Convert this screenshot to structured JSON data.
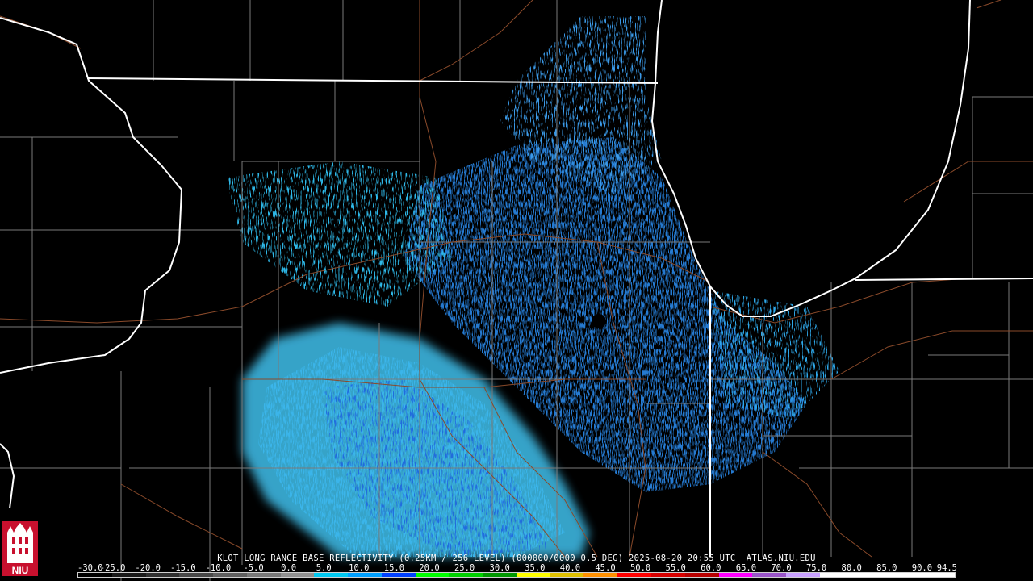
{
  "product": {
    "caption": "KLOT LONG RANGE BASE REFLECTIVITY (0.25KM / 256 LEVEL) (000000/0000 0.5 DEG) 2025-08-20 20:55 UTC  ATLAS.NIU.EDU"
  },
  "logo": {
    "text": "NIU",
    "icon": "niu-tower-icon",
    "color": "#c8102e"
  },
  "scale": {
    "labels": [
      "-30.0",
      "-25.0",
      "-20.0",
      "-15.0",
      "-10.0",
      "-5.0",
      "0.0",
      "5.0",
      "10.0",
      "15.0",
      "20.0",
      "25.0",
      "30.0",
      "35.0",
      "40.0",
      "45.0",
      "50.0",
      "55.0",
      "60.0",
      "65.0",
      "70.0",
      "75.0",
      "80.0",
      "85.0",
      "90.0",
      "94.5"
    ],
    "colors": [
      "#000000",
      "#1a1a1a",
      "#303030",
      "#484848",
      "#606060",
      "#787878",
      "#909090",
      "#00c8f0",
      "#00a0ff",
      "#0040ff",
      "#00ff00",
      "#00d000",
      "#009800",
      "#ffff00",
      "#e0c000",
      "#ff9000",
      "#ff0000",
      "#d80000",
      "#b80000",
      "#ff00ff",
      "#9a55c9",
      "#c8a0ff",
      "#ffffff",
      "#ffffff",
      "#ffffff",
      "#ffffff"
    ]
  }
}
